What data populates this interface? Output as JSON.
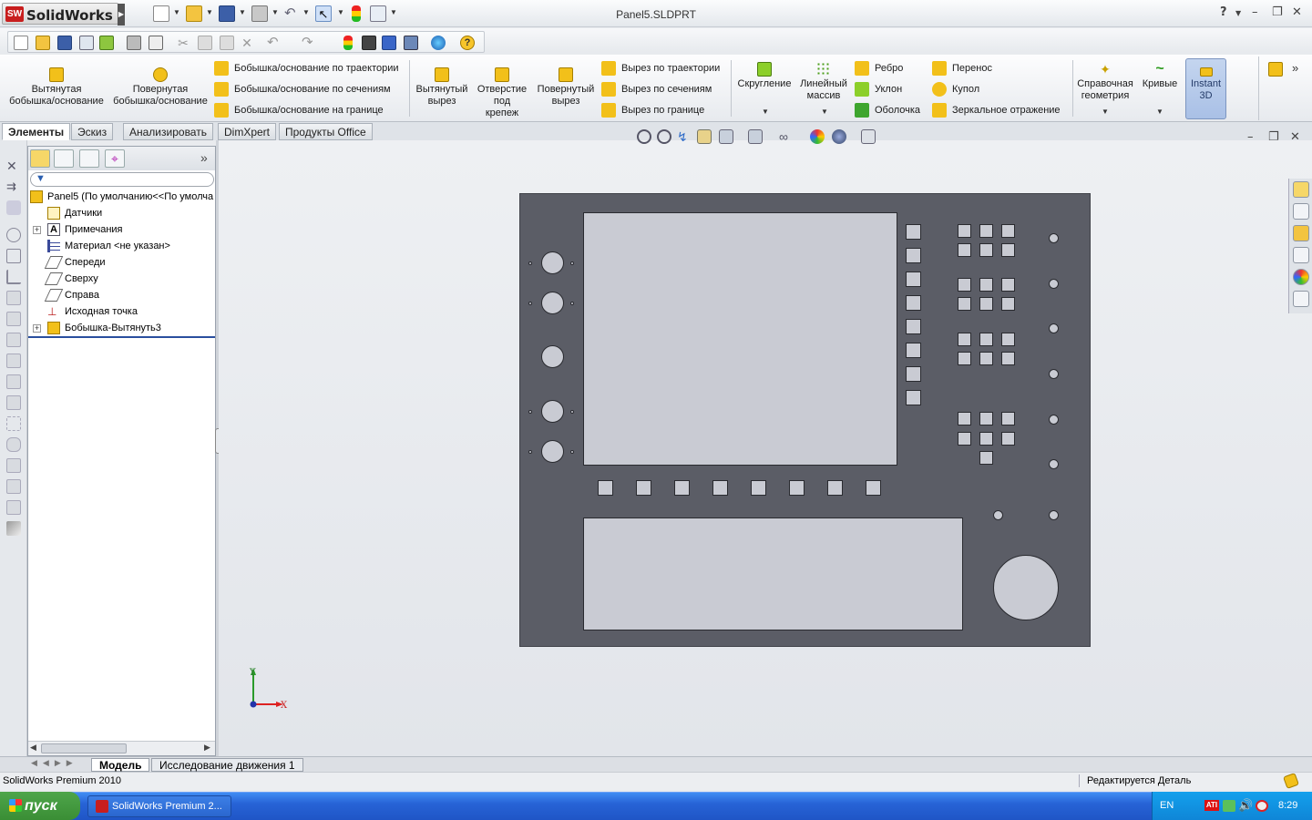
{
  "app": {
    "brand": "SolidWorks",
    "brand_badge": "SW",
    "doc_title": "Panel5.SLDPRT",
    "help_glyph": "?"
  },
  "command_manager": {
    "big_buttons": [
      {
        "label_line1": "Вытянутая",
        "label_line2": "бобышка/основание"
      },
      {
        "label_line1": "Повернутая",
        "label_line2": "бобышка/основание"
      }
    ],
    "boss_rows": [
      "Бобышка/основание по траектории",
      "Бобышка/основание по сечениям",
      "Бобышка/основание на границе"
    ],
    "cut_buttons": [
      {
        "label_line1": "Вытянутый",
        "label_line2": "вырез",
        "label_line3": ""
      },
      {
        "label_line1": "Отверстие",
        "label_line2": "под",
        "label_line3": "крепеж"
      },
      {
        "label_line1": "Повернутый",
        "label_line2": "вырез",
        "label_line3": ""
      }
    ],
    "cut_rows": [
      "Вырез по траектории",
      "Вырез по сечениям",
      "Вырез по границе"
    ],
    "feature_buttons": [
      {
        "label_line1": "Скругление",
        "label_line2": ""
      },
      {
        "label_line1": "Линейный",
        "label_line2": "массив"
      }
    ],
    "feature_rows": [
      "Ребро",
      "Уклон",
      "Оболочка"
    ],
    "feature_rows2": [
      "Перенос",
      "Купол",
      "Зеркальное отражение"
    ],
    "ref_buttons": [
      {
        "label_line1": "Справочная",
        "label_line2": "геометрия"
      },
      {
        "label_line1": "Кривые",
        "label_line2": ""
      }
    ],
    "instant3d": {
      "label_line1": "Instant",
      "label_line2": "3D"
    }
  },
  "tabs": [
    "Элементы",
    "Эскиз",
    "Анализировать",
    "DimXpert",
    "Продукты Office"
  ],
  "feature_tree": {
    "root": "Panel5  (По умолчанию<<По умолча",
    "items": [
      {
        "label": "Датчики",
        "expandable": false
      },
      {
        "label": "Примечания",
        "expandable": true
      },
      {
        "label": "Материал <не указан>",
        "expandable": false
      },
      {
        "label": "Спереди",
        "expandable": false
      },
      {
        "label": "Сверху",
        "expandable": false
      },
      {
        "label": "Справа",
        "expandable": false
      },
      {
        "label": "Исходная точка",
        "expandable": false
      },
      {
        "label": "Бобышка-Вытянуть3",
        "expandable": true
      }
    ],
    "expand_glyph": "»"
  },
  "triad": {
    "x_label": "X",
    "y_label": "Y"
  },
  "bottom_tabs": [
    "Модель",
    "Исследование движения 1"
  ],
  "status": {
    "left": "SolidWorks Premium 2010",
    "right": "Редактируется Деталь"
  },
  "taskbar": {
    "start": "пуск",
    "task": "SolidWorks Premium 2...",
    "lang": "EN",
    "time": "8:29"
  },
  "colors": {
    "panel": "#5b5d66",
    "cutouts": "#c9cbd3",
    "accent_yellow": "#f2c01a",
    "taskbar": "#245edb"
  }
}
